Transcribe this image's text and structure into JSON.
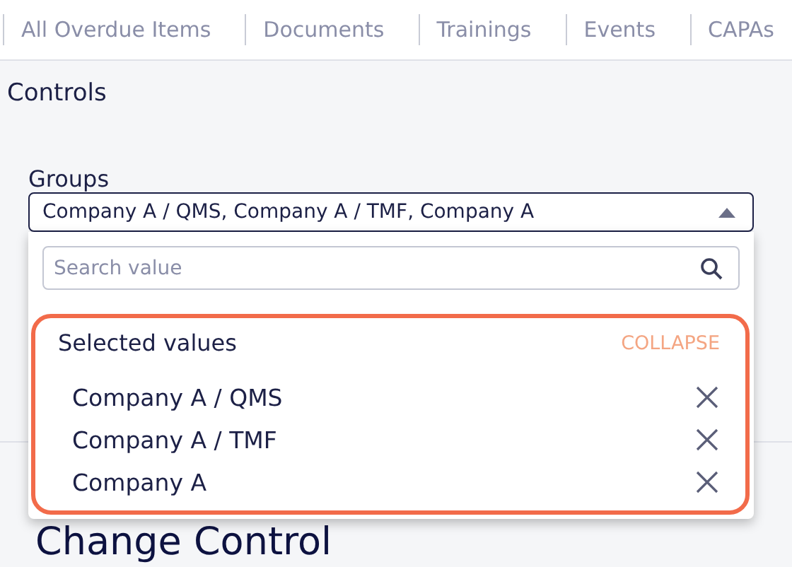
{
  "tabs": [
    {
      "label": "All Overdue Items",
      "selected": false
    },
    {
      "label": "Documents",
      "selected": false
    },
    {
      "label": "Trainings",
      "selected": false
    },
    {
      "label": "Events",
      "selected": false
    },
    {
      "label": "CAPAs",
      "selected": false
    }
  ],
  "section_title": "Controls",
  "groups_field": {
    "label": "Groups",
    "value": "Company A / QMS, Company A / TMF, Company A",
    "expanded": true
  },
  "dropdown": {
    "search": {
      "placeholder": "Search value"
    },
    "selected_title": "Selected values",
    "collapse_label": "COLLAPSE",
    "selected_values": [
      {
        "label": "Company A / QMS"
      },
      {
        "label": "Company A / TMF"
      },
      {
        "label": "Company A"
      }
    ]
  },
  "heading": "Change Control"
}
